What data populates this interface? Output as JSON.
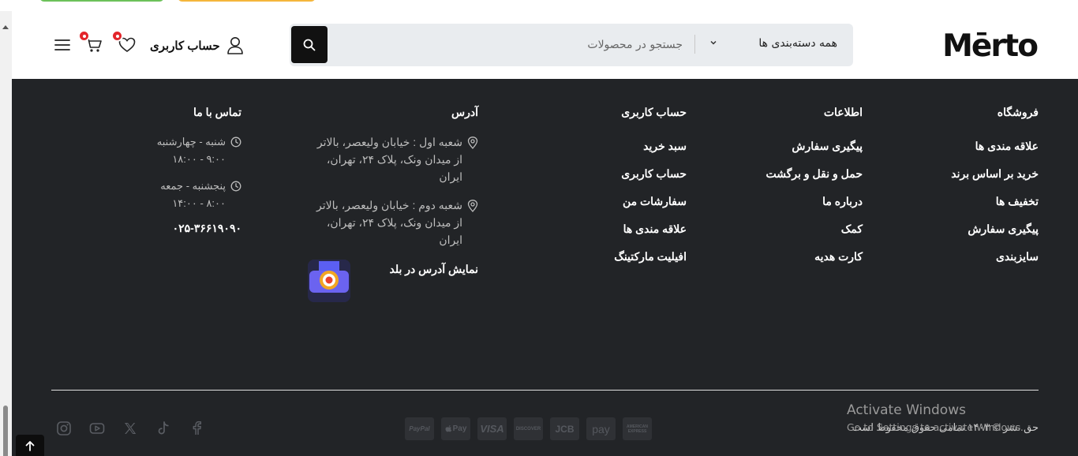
{
  "header": {
    "logo": "Mērto",
    "category": "همه دسته‌بندی ها",
    "search_placeholder": "جستجو در محصولات",
    "account_label": "حساب کاربری"
  },
  "footer": {
    "shop": {
      "title": "فروشگاه",
      "links": [
        "علاقه مندی ها",
        "خرید بر اساس برند",
        "تخفیف ها",
        "پیگیری سفارش",
        "سایزبندی"
      ]
    },
    "info": {
      "title": "اطلاعات",
      "links": [
        "پیگیری سفارش",
        "حمل و نقل و برگشت",
        "درباره ما",
        "کمک",
        "کارت هدیه"
      ]
    },
    "account": {
      "title": "حساب کاربری",
      "links": [
        "سبد خرید",
        "حساب کاربری",
        "سفارشات من",
        "علاقه مندی ها",
        "افیلیت مارکتینگ"
      ]
    },
    "address": {
      "title": "آدرس",
      "branch1": "شعبه اول : خیابان ولیعصر، بالاتر از میدان ونک، پلاک ۲۴، تهران، ایران",
      "branch2": "شعبه دوم : خیابان ولیعصر، بالاتر از میدان ونک، پلاک ۲۴، تهران، ایران",
      "map_label": "نمایش آدرس در بلد"
    },
    "contact": {
      "title": "تماس با ما",
      "days1": "شنبه - چهارشنبه",
      "hours1": "۹:۰۰ - ۱۸:۰۰",
      "days2": "پنجشنبه - جمعه",
      "hours2": "۸:۰۰ - ۱۴:۰۰",
      "phone": "۰۲۵-۳۶۶۱۹۰۹۰"
    },
    "payments": [
      "PayPal",
      "Pay",
      "VISA",
      "DISCOVER",
      "JCB",
      "pay",
      "AMERICAN EXPRESS"
    ],
    "socials": [
      "instagram-icon",
      "youtube-icon",
      "x-icon",
      "tiktok-icon",
      "facebook-icon"
    ],
    "copyright": "حق نشر © ۱۴۰۳ تمامی حقوق محفوظ است"
  },
  "system": {
    "activate_title": "Activate Windows",
    "activate_sub": "Go to Settings to activate Windows."
  }
}
